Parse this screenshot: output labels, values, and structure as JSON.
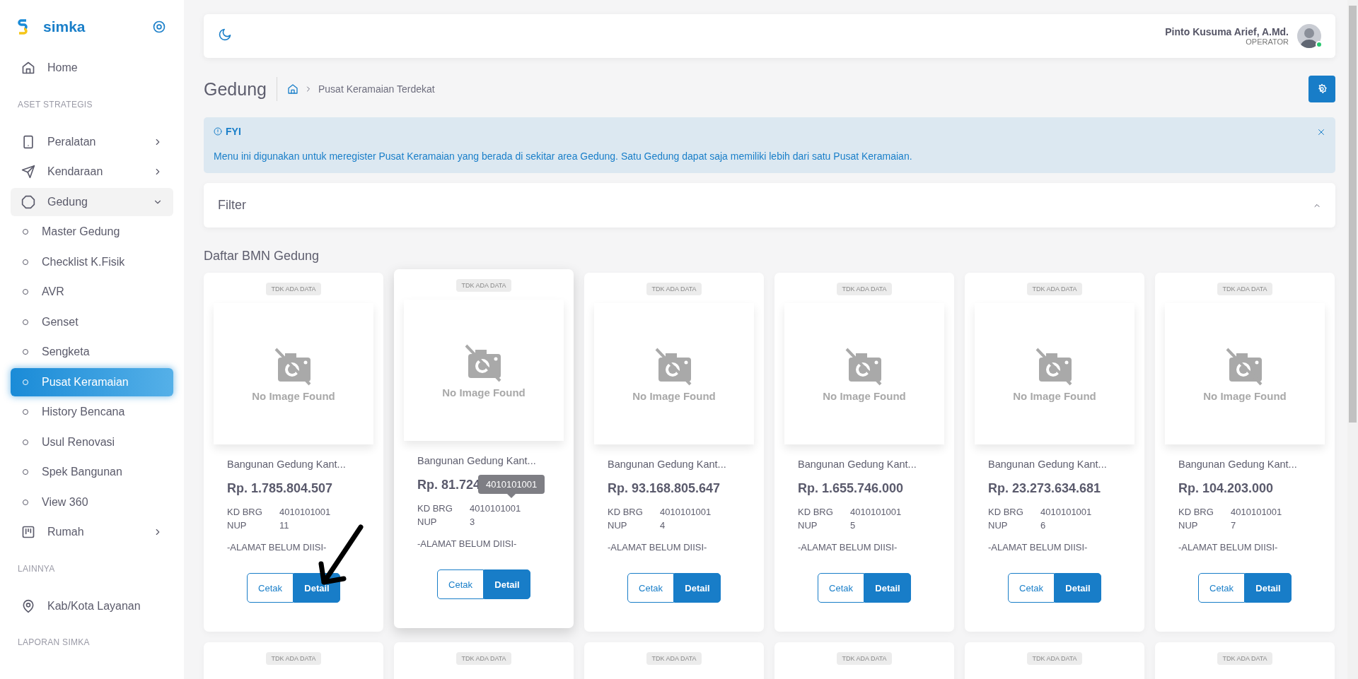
{
  "sidebar": {
    "brand": "simka",
    "items": [
      {
        "kind": "link",
        "label": "Home",
        "selected": false
      },
      {
        "kind": "section",
        "label": "ASET STRATEGIS"
      },
      {
        "kind": "link",
        "label": "Peralatan",
        "selected": false,
        "expanded": false
      },
      {
        "kind": "link",
        "label": "Kendaraan",
        "selected": false,
        "expanded": false
      },
      {
        "kind": "link",
        "label": "Gedung",
        "selected": false,
        "expanded": true
      },
      {
        "kind": "sub",
        "label": "Master Gedung",
        "selected": false
      },
      {
        "kind": "sub",
        "label": "Checklist K.Fisik",
        "selected": false
      },
      {
        "kind": "sub",
        "label": "AVR",
        "selected": false
      },
      {
        "kind": "sub",
        "label": "Genset",
        "selected": false
      },
      {
        "kind": "sub",
        "label": "Sengketa",
        "selected": false
      },
      {
        "kind": "sub",
        "label": "Pusat Keramaian",
        "selected": true
      },
      {
        "kind": "sub",
        "label": "History Bencana",
        "selected": false
      },
      {
        "kind": "sub",
        "label": "Usul Renovasi",
        "selected": false
      },
      {
        "kind": "sub",
        "label": "Spek Bangunan",
        "selected": false
      },
      {
        "kind": "sub",
        "label": "View 360",
        "selected": false
      },
      {
        "kind": "link",
        "label": "Rumah",
        "selected": false,
        "expanded": false
      },
      {
        "kind": "section",
        "label": "LAINNYA"
      },
      {
        "kind": "link",
        "label": "Kab/Kota Layanan",
        "selected": false
      },
      {
        "kind": "section",
        "label": "LAPORAN SIMKA"
      }
    ]
  },
  "header": {
    "user": {
      "name": "Pinto Kusuma Arief, A.Md.",
      "role": "OPERATOR",
      "online": true
    }
  },
  "page": {
    "title": "Gedung",
    "breadcrumb": [
      "Pusat Keramaian Terdekat"
    ]
  },
  "alert": {
    "title": "FYI",
    "message": "Menu ini digunakan untuk meregister Pusat Keramaian yang berada di sekitar area Gedung. Satu Gedung dapat saja memiliki lebih dari satu Pusat Keramaian."
  },
  "filter": {
    "title": "Filter"
  },
  "list_title": "Daftar BMN Gedung",
  "cards": [
    {
      "tag": "TDK ADA DATA",
      "image_text": "No Image Found",
      "name": "Bangunan Gedung Kant...",
      "price": "Rp. 1.785.804.507",
      "kd_label": "KD BRG",
      "kd": "4010101001",
      "nup_label": "NUP",
      "nup": "11",
      "address": "-ALAMAT BELUM DIISI-",
      "buttons": [
        "Cetak",
        "Detail"
      ],
      "hovered": false
    },
    {
      "tag": "TDK ADA DATA",
      "image_text": "No Image Found",
      "name": "Bangunan Gedung Kant...",
      "price": "Rp. 81.724",
      "kd_label": "KD BRG",
      "kd": "4010101001",
      "nup_label": "NUP",
      "nup": "3",
      "address": "-ALAMAT BELUM DIISI-",
      "buttons": [
        "Cetak",
        "Detail"
      ],
      "hovered": true,
      "tooltip": "4010101001"
    },
    {
      "tag": "TDK ADA DATA",
      "image_text": "No Image Found",
      "name": "Bangunan Gedung Kant...",
      "price": "Rp. 93.168.805.647",
      "kd_label": "KD BRG",
      "kd": "4010101001",
      "nup_label": "NUP",
      "nup": "4",
      "address": "-ALAMAT BELUM DIISI-",
      "buttons": [
        "Cetak",
        "Detail"
      ],
      "hovered": false
    },
    {
      "tag": "TDK ADA DATA",
      "image_text": "No Image Found",
      "name": "Bangunan Gedung Kant...",
      "price": "Rp. 1.655.746.000",
      "kd_label": "KD BRG",
      "kd": "4010101001",
      "nup_label": "NUP",
      "nup": "5",
      "address": "-ALAMAT BELUM DIISI-",
      "buttons": [
        "Cetak",
        "Detail"
      ],
      "hovered": false
    },
    {
      "tag": "TDK ADA DATA",
      "image_text": "No Image Found",
      "name": "Bangunan Gedung Kant...",
      "price": "Rp. 23.273.634.681",
      "kd_label": "KD BRG",
      "kd": "4010101001",
      "nup_label": "NUP",
      "nup": "6",
      "address": "-ALAMAT BELUM DIISI-",
      "buttons": [
        "Cetak",
        "Detail"
      ],
      "hovered": false
    },
    {
      "tag": "TDK ADA DATA",
      "image_text": "No Image Found",
      "name": "Bangunan Gedung Kant...",
      "price": "Rp. 104.203.000",
      "kd_label": "KD BRG",
      "kd": "4010101001",
      "nup_label": "NUP",
      "nup": "7",
      "address": "-ALAMAT BELUM DIISI-",
      "buttons": [
        "Cetak",
        "Detail"
      ],
      "hovered": false
    },
    {
      "tag": "TDK ADA DATA"
    },
    {
      "tag": "TDK ADA DATA"
    },
    {
      "tag": "TDK ADA DATA"
    },
    {
      "tag": "TDK ADA DATA"
    },
    {
      "tag": "TDK ADA DATA"
    },
    {
      "tag": "TDK ADA DATA"
    }
  ],
  "annotation": {
    "kind": "arrow"
  }
}
